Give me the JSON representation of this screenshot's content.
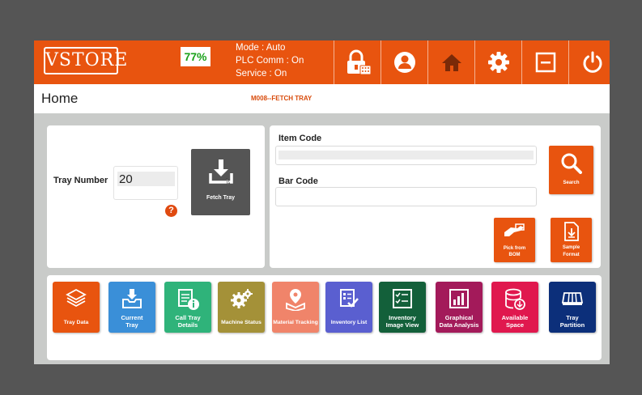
{
  "header": {
    "logo_text": "VSTORE",
    "battery_percent": "77%",
    "status_mode": "Mode : Auto",
    "status_plc": "PLC Comm : On",
    "status_service": "Service : On",
    "icons": [
      "lock-keypad-icon",
      "user-icon",
      "home-icon",
      "gear-icon",
      "minimize-icon",
      "power-icon"
    ]
  },
  "titlebar": {
    "title": "Home",
    "screen_code": "M008--FETCH TRAY"
  },
  "tray_panel": {
    "tray_number_label": "Tray Number",
    "tray_number_value": "20",
    "help_symbol": "?",
    "fetch_button_label": "Fetch Tray"
  },
  "search_panel": {
    "item_code_label": "Item Code",
    "item_code_value": "",
    "bar_code_label": "Bar Code",
    "bar_code_value": "",
    "search_button_label": "Search",
    "pick_bom_label_1": "Pick from",
    "pick_bom_label_2": "BOM",
    "sample_format_label_1": "Sample",
    "sample_format_label_2": "Format"
  },
  "tiles": [
    {
      "line1": "Tray Data",
      "line2": "",
      "color": "#e8540f",
      "icon": "layers-icon"
    },
    {
      "line1": "Current",
      "line2": "Tray",
      "color": "#3a8fd8",
      "icon": "inbox-icon"
    },
    {
      "line1": "Call Tray",
      "line2": "Details",
      "color": "#2fb37a",
      "icon": "document-info-icon"
    },
    {
      "line1": "Machine Status",
      "line2": "",
      "color": "#a49138",
      "icon": "gears-icon"
    },
    {
      "line1": "Material Tracking",
      "line2": "",
      "color": "#f0846a",
      "icon": "location-box-icon"
    },
    {
      "line1": "Inventory List",
      "line2": "",
      "color": "#5a5fd0",
      "icon": "checklist-icon"
    },
    {
      "line1": "Inventory",
      "line2": "Image View",
      "color": "#13603a",
      "icon": "image-list-icon"
    },
    {
      "line1": "Graphical",
      "line2": "Data Analysis",
      "color": "#a31a5a",
      "icon": "bar-chart-icon"
    },
    {
      "line1": "Available",
      "line2": "Space",
      "color": "#e0184e",
      "icon": "database-icon"
    },
    {
      "line1": "Tray",
      "line2": "Partition",
      "color": "#0c2f7a",
      "icon": "tray-partition-icon"
    }
  ]
}
